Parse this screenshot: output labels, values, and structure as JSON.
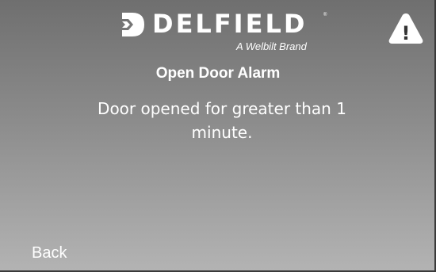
{
  "brand": {
    "name": "DELFIELD",
    "trademark": "®",
    "tagline": "A Welbilt Brand"
  },
  "alert": {
    "icon": "warning-icon",
    "icon_glyph": "!",
    "title": "Open Door Alarm",
    "message": "Door opened for greater than 1 minute."
  },
  "nav": {
    "back_label": "Back"
  },
  "colors": {
    "text": "#ffffff",
    "background_top": "#6f6f6f",
    "background_bottom": "#b3b3b3"
  }
}
